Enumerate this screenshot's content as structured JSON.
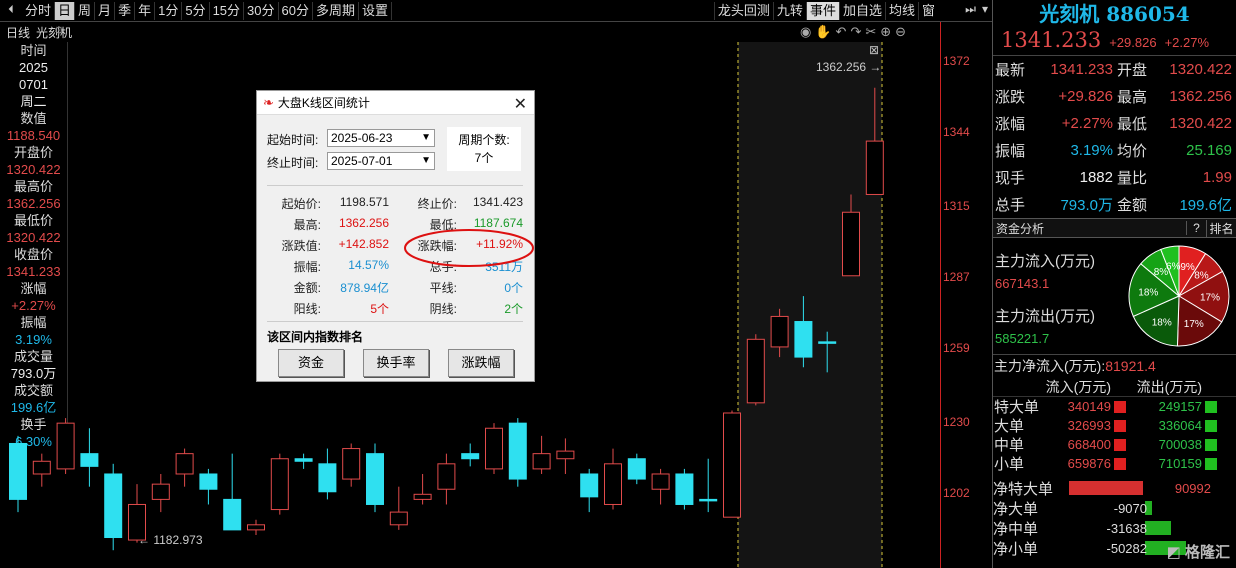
{
  "toolbar": {
    "left_items": [
      "分时",
      "日",
      "周",
      "月",
      "季",
      "年",
      "1分",
      "5分",
      "15分",
      "30分",
      "60分",
      "多周期",
      "设置"
    ],
    "active_item": "日",
    "right_items": [
      "龙头回测",
      "九转",
      "事件",
      "加自选",
      "均线",
      "窗"
    ],
    "right_active": "事件"
  },
  "chart_header": {
    "period": "日线",
    "name": "光刻机"
  },
  "left_info": [
    {
      "label": "时间",
      "value": "2025",
      "value2": "0701",
      "value3": "周二",
      "color": "white"
    },
    {
      "label": "数值",
      "value": "1188.540",
      "color": "red"
    },
    {
      "label": "开盘价",
      "value": "1320.422",
      "color": "red"
    },
    {
      "label": "最高价",
      "value": "1362.256",
      "color": "red"
    },
    {
      "label": "最低价",
      "value": "1320.422",
      "color": "red"
    },
    {
      "label": "收盘价",
      "value": "1341.233",
      "color": "red"
    },
    {
      "label": "涨幅",
      "value": "+2.27%",
      "color": "red"
    },
    {
      "label": "振幅",
      "value": "3.19%",
      "color": "cyan"
    },
    {
      "label": "成交量",
      "value": "793.0万",
      "color": "white"
    },
    {
      "label": "成交额",
      "value": "199.6亿",
      "color": "cyan"
    },
    {
      "label": "换手",
      "value": "6.30%",
      "color": "cyan"
    }
  ],
  "price_axis": [
    "1372",
    "1344",
    "1315",
    "1287",
    "1259",
    "1230",
    "1202"
  ],
  "chart_annotations": {
    "high_label": "1362.256",
    "low_label": "1182.973"
  },
  "chart_data": {
    "type": "candlestick",
    "ylim": [
      1173,
      1380
    ],
    "candles": [
      {
        "o": 1200,
        "h": 1225,
        "l": 1195,
        "c": 1222,
        "color": "cyan"
      },
      {
        "o": 1210,
        "h": 1218,
        "l": 1205,
        "c": 1215,
        "color": "red"
      },
      {
        "o": 1212,
        "h": 1232,
        "l": 1210,
        "c": 1230,
        "color": "red"
      },
      {
        "o": 1218,
        "h": 1228,
        "l": 1205,
        "c": 1213,
        "color": "cyan"
      },
      {
        "o": 1210,
        "h": 1214,
        "l": 1180,
        "c": 1185,
        "color": "cyan"
      },
      {
        "o": 1184,
        "h": 1206,
        "l": 1183,
        "c": 1198,
        "color": "red"
      },
      {
        "o": 1200,
        "h": 1210,
        "l": 1195,
        "c": 1206,
        "color": "red"
      },
      {
        "o": 1210,
        "h": 1220,
        "l": 1205,
        "c": 1218,
        "color": "red"
      },
      {
        "o": 1210,
        "h": 1212,
        "l": 1198,
        "c": 1204,
        "color": "cyan"
      },
      {
        "o": 1200,
        "h": 1218,
        "l": 1190,
        "c": 1188,
        "color": "cyan"
      },
      {
        "o": 1188,
        "h": 1192,
        "l": 1186,
        "c": 1190,
        "color": "red"
      },
      {
        "o": 1196,
        "h": 1218,
        "l": 1194,
        "c": 1216,
        "color": "red"
      },
      {
        "o": 1216,
        "h": 1218,
        "l": 1212,
        "c": 1215,
        "color": "cyan"
      },
      {
        "o": 1214,
        "h": 1220,
        "l": 1200,
        "c": 1203,
        "color": "cyan"
      },
      {
        "o": 1208,
        "h": 1222,
        "l": 1205,
        "c": 1220,
        "color": "red"
      },
      {
        "o": 1218,
        "h": 1222,
        "l": 1195,
        "c": 1198,
        "color": "cyan"
      },
      {
        "o": 1190,
        "h": 1205,
        "l": 1188,
        "c": 1195,
        "color": "red"
      },
      {
        "o": 1200,
        "h": 1210,
        "l": 1198,
        "c": 1202,
        "color": "red"
      },
      {
        "o": 1204,
        "h": 1218,
        "l": 1198,
        "c": 1214,
        "color": "red"
      },
      {
        "o": 1218,
        "h": 1222,
        "l": 1213,
        "c": 1216,
        "color": "cyan"
      },
      {
        "o": 1212,
        "h": 1230,
        "l": 1210,
        "c": 1228,
        "color": "red"
      },
      {
        "o": 1230,
        "h": 1232,
        "l": 1205,
        "c": 1208,
        "color": "cyan"
      },
      {
        "o": 1212,
        "h": 1225,
        "l": 1210,
        "c": 1218,
        "color": "red"
      },
      {
        "o": 1216,
        "h": 1224,
        "l": 1210,
        "c": 1219,
        "color": "red"
      },
      {
        "o": 1210,
        "h": 1212,
        "l": 1195,
        "c": 1201,
        "color": "cyan"
      },
      {
        "o": 1198,
        "h": 1220,
        "l": 1196,
        "c": 1214,
        "color": "red"
      },
      {
        "o": 1216,
        "h": 1218,
        "l": 1206,
        "c": 1208,
        "color": "cyan"
      },
      {
        "o": 1204,
        "h": 1212,
        "l": 1198,
        "c": 1210,
        "color": "red"
      },
      {
        "o": 1210,
        "h": 1212,
        "l": 1196,
        "c": 1198,
        "color": "cyan"
      },
      {
        "o": 1200,
        "h": 1216,
        "l": 1195,
        "c": 1200,
        "color": "cyan"
      },
      {
        "o": 1193,
        "h": 1235,
        "l": 1193,
        "c": 1234,
        "color": "red"
      },
      {
        "o": 1238,
        "h": 1265,
        "l": 1237,
        "c": 1263,
        "color": "red"
      },
      {
        "o": 1260,
        "h": 1275,
        "l": 1256,
        "c": 1272,
        "color": "red"
      },
      {
        "o": 1270,
        "h": 1280,
        "l": 1252,
        "c": 1256,
        "color": "cyan"
      },
      {
        "o": 1262,
        "h": 1266,
        "l": 1250,
        "c": 1262,
        "color": "cyan"
      },
      {
        "o": 1288,
        "h": 1320,
        "l": 1288,
        "c": 1313,
        "color": "red"
      },
      {
        "o": 1320,
        "h": 1362,
        "l": 1320,
        "c": 1341,
        "color": "red"
      }
    ]
  },
  "dialog": {
    "title": "大盘K线区间统计",
    "start_label": "起始时间:",
    "start_value": "2025-06-23",
    "end_label": "终止时间:",
    "end_value": "2025-07-01",
    "period_label": "周期个数:",
    "period_value": "7个",
    "stats_left": [
      {
        "label": "起始价:",
        "value": "1198.571",
        "color": "#222"
      },
      {
        "label": "最高:",
        "value": "1362.256",
        "color": "#d11"
      },
      {
        "label": "涨跌值:",
        "value": "+142.852",
        "color": "#d11"
      },
      {
        "label": "振幅:",
        "value": "14.57%",
        "color": "#1a8fd0"
      },
      {
        "label": "金额:",
        "value": "878.94亿",
        "color": "#1a8fd0"
      },
      {
        "label": "阳线:",
        "value": "5个",
        "color": "#d11"
      }
    ],
    "stats_right": [
      {
        "label": "终止价:",
        "value": "1341.423",
        "color": "#222"
      },
      {
        "label": "最低:",
        "value": "1187.674",
        "color": "#1a9a2a"
      },
      {
        "label": "涨跌幅:",
        "value": "+11.92%",
        "color": "#d11"
      },
      {
        "label": "总手:",
        "value": "3511万",
        "color": "#1a8fd0"
      },
      {
        "label": "平线:",
        "value": "0个",
        "color": "#1a8fd0"
      },
      {
        "label": "阴线:",
        "value": "2个",
        "color": "#1a9a2a"
      }
    ],
    "ranking_label": "该区间内指数排名",
    "buttons": [
      "资金",
      "换手率",
      "涨跌幅"
    ]
  },
  "right_panel": {
    "title": "光刻机 886054",
    "price": "1341.233",
    "change": "+29.826",
    "change_pct": "+2.27%",
    "quotes": [
      {
        "l1": "最新",
        "v1": "1341.233",
        "c1": "red",
        "l2": "开盘",
        "v2": "1320.422",
        "c2": "red"
      },
      {
        "l1": "涨跌",
        "v1": "+29.826",
        "c1": "red",
        "l2": "最高",
        "v2": "1362.256",
        "c2": "red"
      },
      {
        "l1": "涨幅",
        "v1": "+2.27%",
        "c1": "red",
        "l2": "最低",
        "v2": "1320.422",
        "c2": "red"
      },
      {
        "l1": "振幅",
        "v1": "3.19%",
        "c1": "cyan",
        "l2": "均价",
        "v2": "25.169",
        "c2": "green"
      },
      {
        "l1": "现手",
        "v1": "1882",
        "c1": "white",
        "l2": "量比",
        "v2": "1.99",
        "c2": "red"
      },
      {
        "l1": "总手",
        "v1": "793.0万",
        "c1": "cyan",
        "l2": "金额",
        "v2": "199.6亿",
        "c2": "cyan"
      }
    ],
    "fund_header": "资金分析",
    "fund_help": "?",
    "fund_rank": "排名",
    "inflow_label": "主力流入(万元)",
    "inflow_value": "667143.1",
    "outflow_label": "主力流出(万元)",
    "outflow_value": "585221.7",
    "net_label": "主力净流入(万元):",
    "net_value": "81921.4",
    "pie_labels": [
      "9%",
      "8%",
      "17%",
      "17%",
      "18%",
      "18%",
      "8%",
      "6%"
    ],
    "flow_headers": [
      "流入(万元)",
      "流出(万元)"
    ],
    "flow_rows": [
      {
        "name": "特大单",
        "in": "340149",
        "out": "249157"
      },
      {
        "name": "大单",
        "in": "326993",
        "out": "336064"
      },
      {
        "name": "中单",
        "in": "668400",
        "out": "700038"
      },
      {
        "name": "小单",
        "in": "659876",
        "out": "710159"
      }
    ],
    "net_rows": [
      {
        "name": "净特大单",
        "value": "90992",
        "color": "red",
        "fill": 1.0
      },
      {
        "name": "净大单",
        "value": "-9070",
        "color": "green",
        "fill": 0.1
      },
      {
        "name": "净中单",
        "value": "-31638",
        "color": "green",
        "fill": 0.35
      },
      {
        "name": "净小单",
        "value": "-50282",
        "color": "green",
        "fill": 0.55
      }
    ],
    "watermark": "格隆汇"
  }
}
